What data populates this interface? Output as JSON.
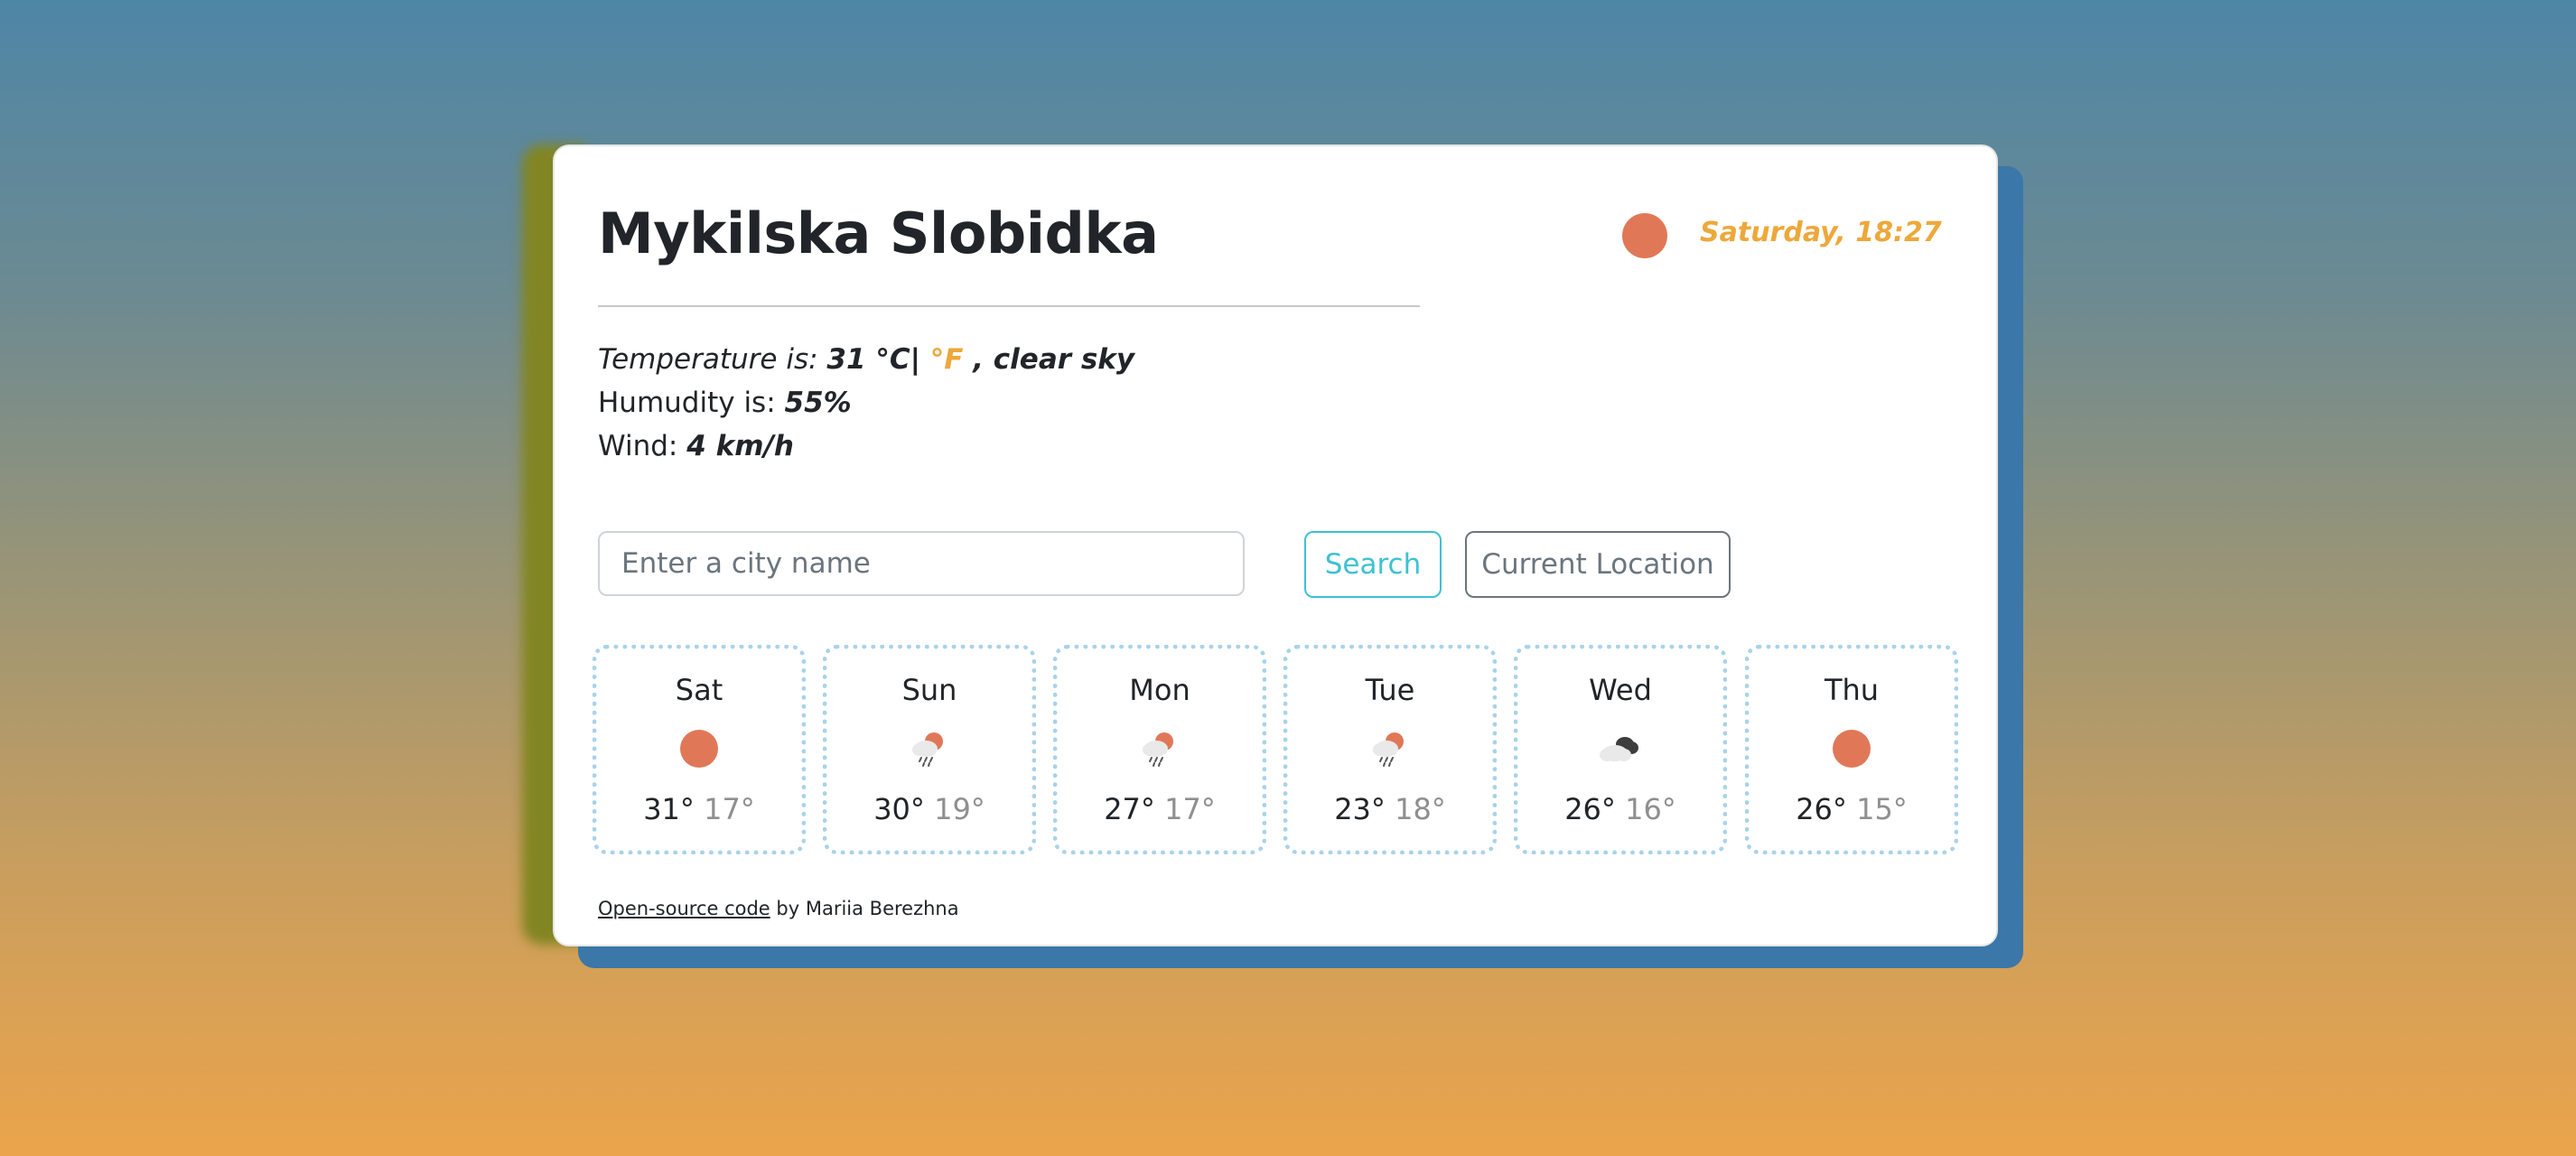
{
  "header": {
    "city": "Mykilska Slobidka",
    "datetime": "Saturday, 18:27",
    "current_icon": "sun-icon"
  },
  "current": {
    "temperature_label": "Temperature is:",
    "temperature_value": "31",
    "celsius_unit": "°C|",
    "fahrenheit_unit": "°F",
    "description": ", clear sky",
    "humidity_label": "Humudity is:",
    "humidity_value": "55%",
    "wind_label": "Wind:",
    "wind_value": "4 km/h"
  },
  "search": {
    "placeholder": "Enter a city name",
    "search_label": "Search",
    "location_label": "Current Location"
  },
  "forecast": [
    {
      "day": "Sat",
      "icon": "sun-icon",
      "max": "31°",
      "min": "17°"
    },
    {
      "day": "Sun",
      "icon": "sun-rain-cloud-icon",
      "max": "30°",
      "min": "19°"
    },
    {
      "day": "Mon",
      "icon": "sun-rain-cloud-icon",
      "max": "27°",
      "min": "17°"
    },
    {
      "day": "Tue",
      "icon": "sun-rain-cloud-icon",
      "max": "23°",
      "min": "18°"
    },
    {
      "day": "Wed",
      "icon": "broken-clouds-icon",
      "max": "26°",
      "min": "16°"
    },
    {
      "day": "Thu",
      "icon": "sun-icon",
      "max": "26°",
      "min": "15°"
    }
  ],
  "footer": {
    "link_text": "Open-source code",
    "author_text": " by Mariia Berezhna"
  },
  "colors": {
    "accent": "#eda83a",
    "sun": "#e07858",
    "search_button": "#3ec1d3",
    "card_border_dots": "#a8d3ea"
  }
}
